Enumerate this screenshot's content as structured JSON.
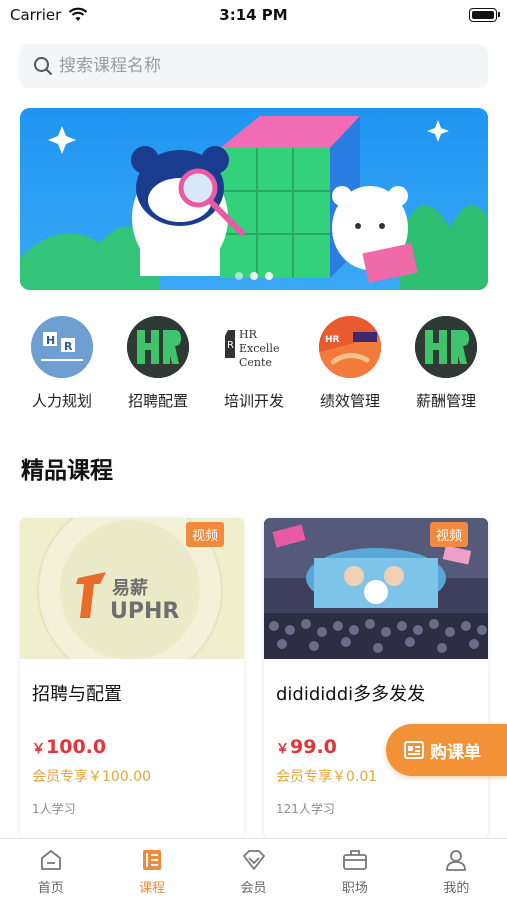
{
  "status_bar": {
    "carrier": "Carrier",
    "time": "3:14 PM"
  },
  "search": {
    "placeholder": "搜索课程名称"
  },
  "banner": {
    "dots": 3,
    "active_dot": 0
  },
  "categories": [
    {
      "label": "人力规划",
      "icon": "hr-planning-icon"
    },
    {
      "label": "招聘配置",
      "icon": "hr-logo-icon"
    },
    {
      "label": "培训开发",
      "icon": "hr-excellence-center-logo",
      "logo_text": [
        "HR",
        "Excelle",
        "Cente"
      ]
    },
    {
      "label": "绩效管理",
      "icon": "performance-icon"
    },
    {
      "label": "薪酬管理",
      "icon": "hr-logo-icon"
    }
  ],
  "section": {
    "title": "精品课程"
  },
  "courses": [
    {
      "tag": "视频",
      "title": "招聘与配置",
      "currency": "￥",
      "price": "100.0",
      "vip_price": "会员专享￥100.00",
      "learners": "1人学习",
      "thumb_text": "UPHR",
      "thumb_cn": "易薪"
    },
    {
      "tag": "视频",
      "title": "didididdi多多发发",
      "currency": "￥",
      "price": "99.0",
      "vip_price": "会员专享￥0.01",
      "learners": "121人学习"
    }
  ],
  "cart_button": {
    "label": "购课单"
  },
  "tabbar": [
    {
      "label": "首页",
      "icon": "home-icon",
      "active": false
    },
    {
      "label": "课程",
      "icon": "course-icon",
      "active": true
    },
    {
      "label": "会员",
      "icon": "vip-icon",
      "active": false
    },
    {
      "label": "职场",
      "icon": "briefcase-icon",
      "active": false
    },
    {
      "label": "我的",
      "icon": "profile-icon",
      "active": false
    }
  ],
  "colors": {
    "accent": "#f08a3e",
    "price": "#e5333a",
    "vip": "#e0a63f"
  }
}
